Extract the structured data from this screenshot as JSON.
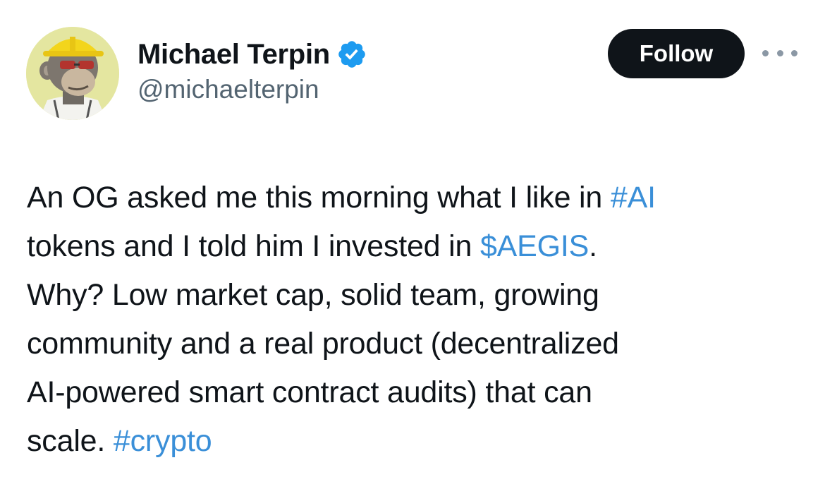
{
  "author": {
    "display_name": "Michael Terpin",
    "handle": "@michaelterpin",
    "verified_icon": "verified-badge-icon",
    "avatar_icon": "bored-ape-avatar"
  },
  "actions": {
    "follow_label": "Follow",
    "more_icon": "more-options-icon"
  },
  "tweet": {
    "lines": [
      [
        {
          "text": "An OG asked me this morning what I like in ",
          "link": false
        },
        {
          "text": "#AI",
          "link": true
        }
      ],
      [
        {
          "text": "tokens and I told him I invested in ",
          "link": false
        },
        {
          "text": "$AEGIS",
          "link": true
        },
        {
          "text": ".",
          "link": false
        }
      ],
      [
        {
          "text": "Why? Low market cap, solid team, growing",
          "link": false
        }
      ],
      [
        {
          "text": "community and a real product (decentralized",
          "link": false
        }
      ],
      [
        {
          "text": "AI-powered smart contract audits) that can",
          "link": false
        }
      ],
      [
        {
          "text": "scale. ",
          "link": false
        },
        {
          "text": "#crypto",
          "link": true
        }
      ]
    ]
  },
  "colors": {
    "link": "#3a8fd8",
    "text": "#0f1419",
    "secondary": "#536471",
    "verified": "#1d9bf0",
    "follow_bg": "#0f1419"
  }
}
